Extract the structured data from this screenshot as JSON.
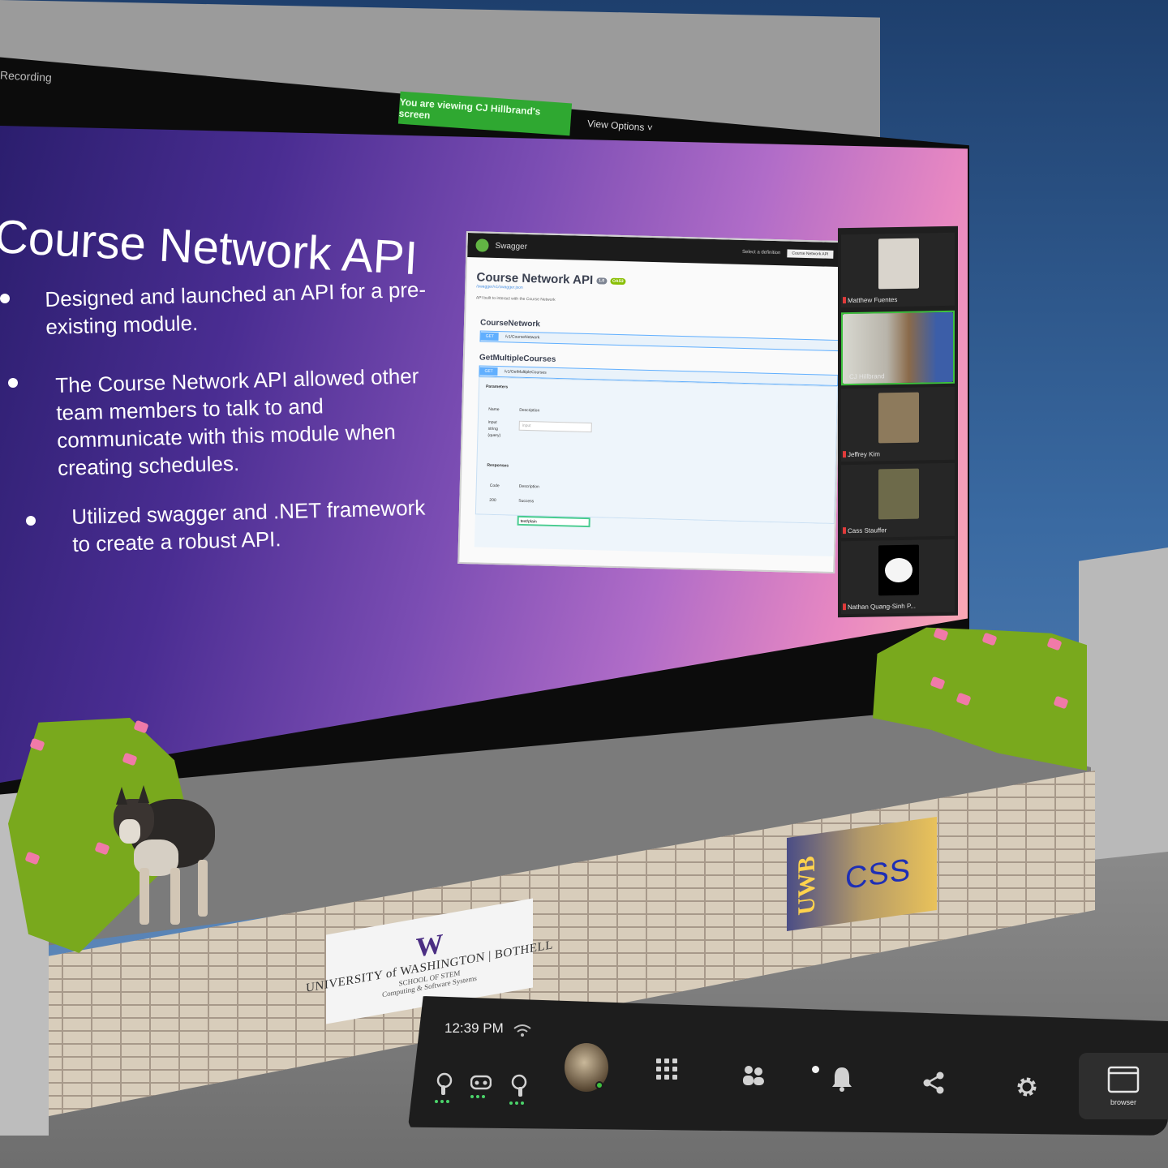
{
  "zoom": {
    "recording_label": "Recording",
    "viewing_banner": "You are viewing CJ Hillbrand's screen",
    "view_options": "View Options ˅"
  },
  "slide": {
    "title": "Course Network API",
    "bullets": [
      "Designed and launched an API for a pre-existing module.",
      "The Course Network API allowed other team members to talk to and communicate with this module when creating schedules.",
      "Utilized swagger and .NET framework to create a robust API."
    ]
  },
  "swagger": {
    "brand": "Swagger",
    "select_label": "Select a definition",
    "select_value": "Course Network API",
    "title": "Course Network API",
    "version_tag": "1.0",
    "oas_tag": "OAS3",
    "link": "/swagger/v1/swagger.json",
    "description": "API built to interact with the Course Network",
    "sections": [
      {
        "name": "CourseNetwork",
        "method": "GET",
        "path": "/v1/CourseNetwork"
      },
      {
        "name": "GetMultipleCourses",
        "method": "GET",
        "path": "/v1/GetMultipleCourses"
      }
    ],
    "parameters_label": "Parameters",
    "param_name_header": "Name",
    "param_desc_header": "Description",
    "param_name": "input",
    "param_type": "string",
    "param_in": "(query)",
    "param_placeholder": "input",
    "responses_label": "Responses",
    "code_header": "Code",
    "desc_header": "Description",
    "response_code": "200",
    "response_desc": "Success",
    "media_type": "text/plain"
  },
  "participants": [
    {
      "name": "Matthew Fuentes",
      "active": false,
      "thumb_color": "#d9d4cc"
    },
    {
      "name": "CJ Hillbrand",
      "active": true,
      "thumb_color": "#8a6a4a"
    },
    {
      "name": "Jeffrey Kim",
      "active": false,
      "thumb_color": "#8d7a5c"
    },
    {
      "name": "Cass Stauffer",
      "active": false,
      "thumb_color": "#6d6a4a"
    },
    {
      "name": "Nathan Quang-Sinh P...",
      "active": false,
      "thumb_color": "#f5f5f5"
    }
  ],
  "signs": {
    "uw_logo": "W",
    "uw_line": "UNIVERSITY of WASHINGTON | BOTHELL",
    "uw_school": "SCHOOL OF STEM",
    "uw_division": "Computing & Software Systems",
    "uwb": "UWB",
    "css": "CSS"
  },
  "dock": {
    "time": "12:39 PM",
    "browser_label": "browser",
    "icons": {
      "wifi": "wifi-icon",
      "left_controller": "left-controller-icon",
      "headset": "headset-icon",
      "right_controller": "right-controller-icon",
      "apps": "apps-grid-icon",
      "people": "people-icon",
      "notifications": "bell-icon",
      "share": "share-icon",
      "settings": "gear-icon",
      "browser": "browser-window-icon"
    }
  },
  "colors": {
    "zoom_green": "#2fa831",
    "slide_gradient_start": "#2b1e6e",
    "slide_gradient_end": "#ffb3b0",
    "bush": "#79a91d",
    "blossom": "#f07aa8"
  }
}
